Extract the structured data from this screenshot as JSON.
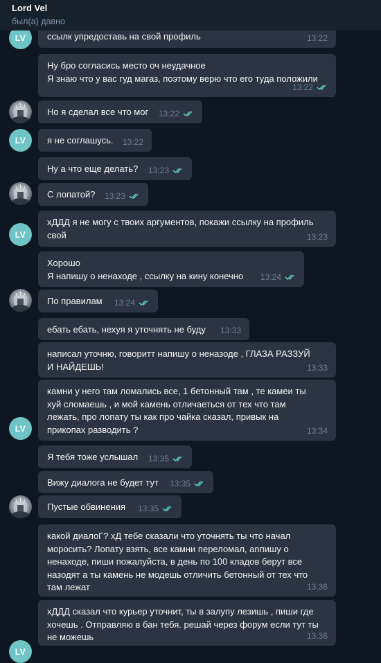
{
  "header": {
    "name": "Lord Vel",
    "status": "был(а) давно"
  },
  "avatar_initials": "LV",
  "messages": [
    {
      "text": "ссылк упредоставь на свой профиль",
      "time": "13:22",
      "read": false
    },
    {
      "text": "Ну бро согласись место оч неудачное\nЯ знаю что у вас гуд магаз, поэтому верю что его туда положили",
      "time": "13:22",
      "read": true
    },
    {
      "text": "Но я сделал все что мог",
      "time": "13:22",
      "read": true
    },
    {
      "text": "я не соглашусь.",
      "time": "13:22",
      "read": false
    },
    {
      "text": "Ну а что еще делать?",
      "time": "13:23",
      "read": true
    },
    {
      "text": "С лопатой?",
      "time": "13:23",
      "read": true
    },
    {
      "text": "хДДД я не могу с твоих аргументов, покажи ссылку на профиль\nсвой",
      "time": "13:23",
      "read": false
    },
    {
      "text": "Хорошо\nЯ напишу о ненаходе , ссылку на кину конечно",
      "time": "13:24",
      "read": true
    },
    {
      "text": "По правилам",
      "time": "13:24",
      "read": true
    },
    {
      "text": "ебать ебать, нехуя я уточнять не буду",
      "time": "13:33",
      "read": false
    },
    {
      "text": "написал уточню, говоритт напишу о неназоде , ГЛАЗА РАЗЗУЙ\nИ НАЙДЕШЬ!",
      "time": "13:33",
      "read": false
    },
    {
      "text": "камни у него там ломались все, 1 бетонный там , те камеи ты\nхуй сломаешь , и мой камень отличаеться от тех что там\nлежать, про лопату ты как про чайка сказал, привык на\nприкопах разводить ?",
      "time": "13:34",
      "read": false
    },
    {
      "text": "Я тебя тоже услышал",
      "time": "13:35",
      "read": true
    },
    {
      "text": "Вижу диалога не будет тут",
      "time": "13:35",
      "read": true
    },
    {
      "text": "Пустые обвинения",
      "time": "13:35",
      "read": true
    },
    {
      "text": "какой диалоГ? хД тебе сказали что уточнять ты что начал\nморосить? Лопату взять, все камни переломал, anпишу о\nненаходе, пиши пожалуйста, в день по 100 кладов берут все\nназодят а ты камень не модешь отличить бетонный от тех что\nтам лежат",
      "time": "13:36",
      "read": false
    },
    {
      "text": "хДДД сказал что курьер уточнит, ты в залупу лезишь , пиши где\nхочешь . Отправляю в бан тебя. решай через форум если тут ты\nне можешь",
      "time": "13:36",
      "read": false
    }
  ],
  "colors": {
    "background": "#0e1621",
    "header": "#17212b",
    "bubble": "#2b3440",
    "check": "#5fd3c3",
    "avatar": "#6fc5c5"
  }
}
